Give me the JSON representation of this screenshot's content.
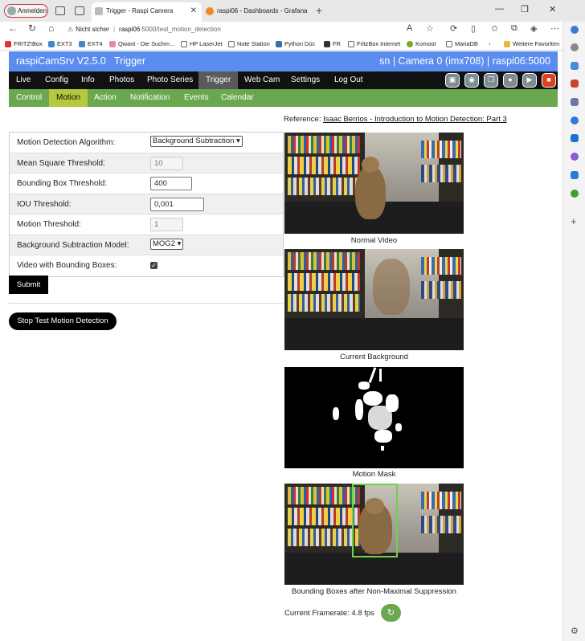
{
  "browser": {
    "profile_label": "Anmelden",
    "tabs": [
      {
        "title": "Trigger - Raspi Camera",
        "active": true
      },
      {
        "title": "raspi06 - Dashboards - Grafana",
        "active": false
      }
    ],
    "address": {
      "security": "Nicht sicher",
      "host": "raspi06",
      "path": ":5000/test_motion_detection"
    },
    "bookmarks": [
      "FRITZ!Box",
      "EXT3",
      "EXT4",
      "Qwant - Die Suchm...",
      "HP LaserJet",
      "Note Station",
      "Python Doc",
      "FR",
      "FritzBox Internet",
      "Komoot",
      "MariaDB",
      "Weitere Favoriten"
    ]
  },
  "app": {
    "title": "raspiCamSrv V2.5.0",
    "page": "Trigger",
    "camera_info": "sn | Camera 0 (imx708) | raspi06:5000",
    "main_nav": [
      "Live",
      "Config",
      "Info",
      "Photos",
      "Photo Series",
      "Trigger",
      "Web Cam",
      "Settings",
      "Log Out"
    ],
    "main_nav_active": "Trigger",
    "sub_nav": [
      "Control",
      "Motion",
      "Action",
      "Notification",
      "Events",
      "Calendar"
    ],
    "sub_nav_active": "Motion"
  },
  "form": {
    "algorithm_label": "Motion Detection Algorithm:",
    "algorithm_value": "Background Subtraction",
    "mse_label": "Mean Square Threshold:",
    "mse_value": "10",
    "bbox_label": "Bounding Box Threshold:",
    "bbox_value": "400",
    "iou_label": "IOU Threshold:",
    "iou_value": "0,001",
    "motion_label": "Motion Threshold:",
    "motion_value": "1",
    "bgmodel_label": "Background Subtraction Model:",
    "bgmodel_value": "MOG2",
    "video_bbox_label": "Video with Bounding Boxes:",
    "video_bbox_checked": true,
    "submit_label": "Submit",
    "stop_label": "Stop Test Motion Detection"
  },
  "reference": {
    "prefix": "Reference:",
    "link_text": "Isaac Berrios - Introduction to Motion Detection: Part 3"
  },
  "images": [
    {
      "caption": "Normal Video"
    },
    {
      "caption": "Current Background"
    },
    {
      "caption": "Motion Mask"
    },
    {
      "caption": "Bounding Boxes after Non-Maximal Suppression"
    }
  ],
  "framerate": {
    "label": "Current Framerate: 4.8 fps"
  },
  "colors": {
    "header_bg": "#5b8def",
    "nav_bg": "#111111",
    "subnav_bg": "#6aa84f",
    "subnav_active": "#b6c93c",
    "bbox": "#6cd44e"
  }
}
